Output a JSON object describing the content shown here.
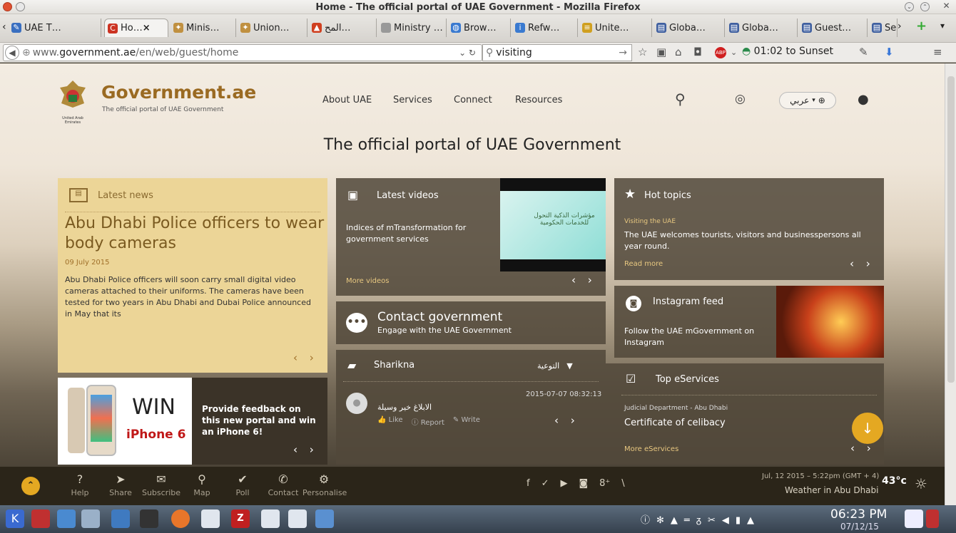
{
  "window": {
    "title": "Home - The official portal of UAE Government - Mozilla Firefox"
  },
  "tabs": [
    {
      "label": "UAE T…",
      "icon": "pen-icon",
      "color": "#3a6fc0"
    },
    {
      "label": "Ho…",
      "icon": "c-icon",
      "color": "#cc3322",
      "active": true
    },
    {
      "label": "Minis…",
      "icon": "emblem-icon",
      "color": "#c09040"
    },
    {
      "label": "Union…",
      "icon": "emblem-icon",
      "color": "#c09040"
    },
    {
      "label": "المح…",
      "icon": "flame-icon",
      "color": "#d04020"
    },
    {
      "label": "Ministry …",
      "icon": "blank-icon",
      "color": "#999999"
    },
    {
      "label": "Brow…",
      "icon": "globe-icon",
      "color": "#3a7ad0"
    },
    {
      "label": "Refw…",
      "icon": "info-icon",
      "color": "#3a7ad0"
    },
    {
      "label": "Unite…",
      "icon": "lines-icon",
      "color": "#d0a020"
    },
    {
      "label": "Globa…",
      "icon": "book-icon",
      "color": "#4060a0"
    },
    {
      "label": "Globa…",
      "icon": "book-icon",
      "color": "#4060a0"
    },
    {
      "label": "Guest…",
      "icon": "book-icon",
      "color": "#4060a0"
    },
    {
      "label": "Se",
      "icon": "book-icon",
      "color": "#4060a0"
    }
  ],
  "nav": {
    "url_prefix": "www.",
    "url_domain": "government.ae",
    "url_path": "/en/web/guest/home",
    "search_value": "visiting",
    "sunset": "01:02 to Sunset"
  },
  "site": {
    "logo_title": "Government.ae",
    "logo_sub": "The official portal of UAE Government",
    "emblem_caption": "United Arab Emirates",
    "menu": [
      "About UAE",
      "Services",
      "Connect",
      "Resources"
    ],
    "lang": "عربي",
    "page_title": "The official portal of UAE Government"
  },
  "news": {
    "label": "Latest news",
    "headline": "Abu Dhabi Police officers to wear body cameras",
    "date": "09 July 2015",
    "body": "Abu Dhabi Police officers will soon carry small digital video cameras attached to their uniforms. The cameras have been tested for two years in Abu Dhabi and Dubai Police announced in May that its"
  },
  "promo": {
    "win": "WIN",
    "phone": "iPhone 6",
    "text": "Provide feedback on this new portal and win an iPhone 6!"
  },
  "videos": {
    "label": "Latest videos",
    "title": "Indices of mTransformation for government services",
    "more": "More videos",
    "thumb_text": "مؤشرات الذكية التحول للخدمات الحكومية"
  },
  "contact": {
    "title": "Contact government",
    "sub": "Engage with the UAE Government"
  },
  "sharikna": {
    "label": "Sharikna",
    "filter": "التوعية",
    "timestamp": "2015-07-07 08:32:13",
    "post": "الابلاغ خير وسيلة",
    "like": "Like",
    "report": "Report",
    "write": "Write"
  },
  "hot": {
    "label": "Hot topics",
    "sub": "Visiting the UAE",
    "text": "The UAE welcomes tourists, visitors and businesspersons all year round.",
    "more": "Read more"
  },
  "instagram": {
    "label": "Instagram feed",
    "text": "Follow the UAE mGovernment on Instagram"
  },
  "eservices": {
    "label": "Top eServices",
    "dept": "Judicial Department - Abu Dhabi",
    "service": "Certificate of celibacy",
    "more": "More eServices"
  },
  "footer": {
    "items": [
      {
        "label": "Help",
        "icon": "help-icon",
        "glyph": "?"
      },
      {
        "label": "Share",
        "icon": "share-icon",
        "glyph": "➤"
      },
      {
        "label": "Subscribe",
        "icon": "subscribe-icon",
        "glyph": "✉"
      },
      {
        "label": "Map",
        "icon": "map-icon",
        "glyph": "⚲"
      },
      {
        "label": "Poll",
        "icon": "poll-icon",
        "glyph": "✔"
      },
      {
        "label": "Contact",
        "icon": "phone-icon",
        "glyph": "✆"
      },
      {
        "label": "Personalise",
        "icon": "personalise-icon",
        "glyph": "⚙"
      }
    ],
    "social": [
      "f",
      "t",
      "yt",
      "ig",
      "g+",
      "rss"
    ],
    "weather_date": "Jul, 12 2015 – 5:22pm (GMT + 4)",
    "weather_place": "Weather in Abu Dhabi",
    "temp": "43°c"
  },
  "taskbar": {
    "time": "06:23 PM",
    "date": "07/12/15"
  }
}
